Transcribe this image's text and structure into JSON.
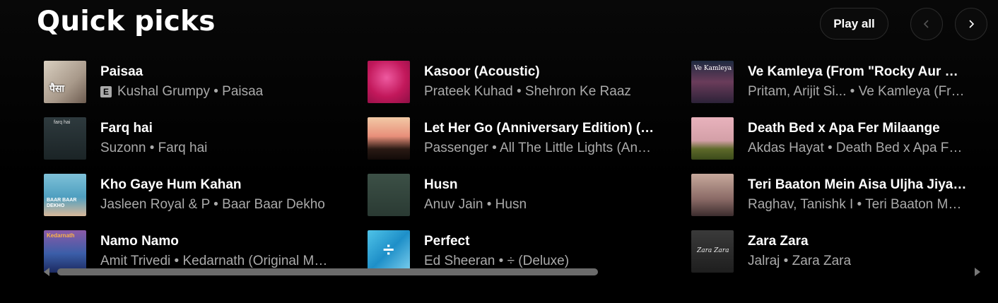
{
  "section": {
    "title": "Quick picks",
    "play_all_label": "Play all"
  },
  "colors": {
    "background": "#000000",
    "subtext": "#aaaaaa",
    "scroll_thumb": "#6b6b6b"
  },
  "icons": {
    "prev": "chevron-left-icon",
    "next": "chevron-right-icon",
    "explicit": "explicit-badge-icon"
  },
  "items": [
    {
      "title": "Paisaa",
      "explicit": true,
      "subtitle": "Kushal Grumpy • Paisaa",
      "thumb_label": "पैसा"
    },
    {
      "title": "Kasoor (Acoustic)",
      "explicit": false,
      "subtitle": "Prateek Kuhad • Shehron Ke Raaz",
      "thumb_label": ""
    },
    {
      "title": "Ve Kamleya (From \"Rocky Aur Rani Kii Prem Kahaani\")",
      "explicit": false,
      "subtitle": "Pritam, Arijit Si... • Ve Kamleya (From...",
      "thumb_label": "Ve Kamleya"
    },
    {
      "title": "Farq hai",
      "explicit": false,
      "subtitle": "Suzonn • Farq hai",
      "thumb_label": "farq hai"
    },
    {
      "title": "Let Her Go (Anniversary Edition) (feat. Ed Sheeran)",
      "explicit": false,
      "subtitle": "Passenger • All The Little Lights (Anniversary Edition)",
      "thumb_label": ""
    },
    {
      "title": "Death Bed x Apa Fer Milaange",
      "explicit": false,
      "subtitle": "Akdas Hayat • Death Bed x Apa Fer Milaange",
      "thumb_label": ""
    },
    {
      "title": "Kho Gaye Hum Kahan",
      "explicit": false,
      "subtitle": "Jasleen Royal & P • Baar Baar Dekho",
      "thumb_label": "BAAR BAAR DEKHO"
    },
    {
      "title": "Husn",
      "explicit": false,
      "subtitle": "Anuv Jain • Husn",
      "thumb_label": ""
    },
    {
      "title": "Teri Baaton Mein Aisa Uljha Jiya (Title Track)",
      "explicit": false,
      "subtitle": "Raghav, Tanishk I • Teri Baaton Mein Aisa Uljha Jiya",
      "thumb_label": ""
    },
    {
      "title": "Namo Namo",
      "explicit": false,
      "subtitle": "Amit Trivedi • Kedarnath (Original Motion Picture Soundtrack)",
      "thumb_label": "Kedarnath"
    },
    {
      "title": "Perfect",
      "explicit": false,
      "subtitle": "Ed Sheeran • ÷ (Deluxe)",
      "thumb_label": "÷"
    },
    {
      "title": "Zara Zara",
      "explicit": false,
      "subtitle": "Jalraj • Zara Zara",
      "thumb_label": "Zara Zara"
    }
  ]
}
